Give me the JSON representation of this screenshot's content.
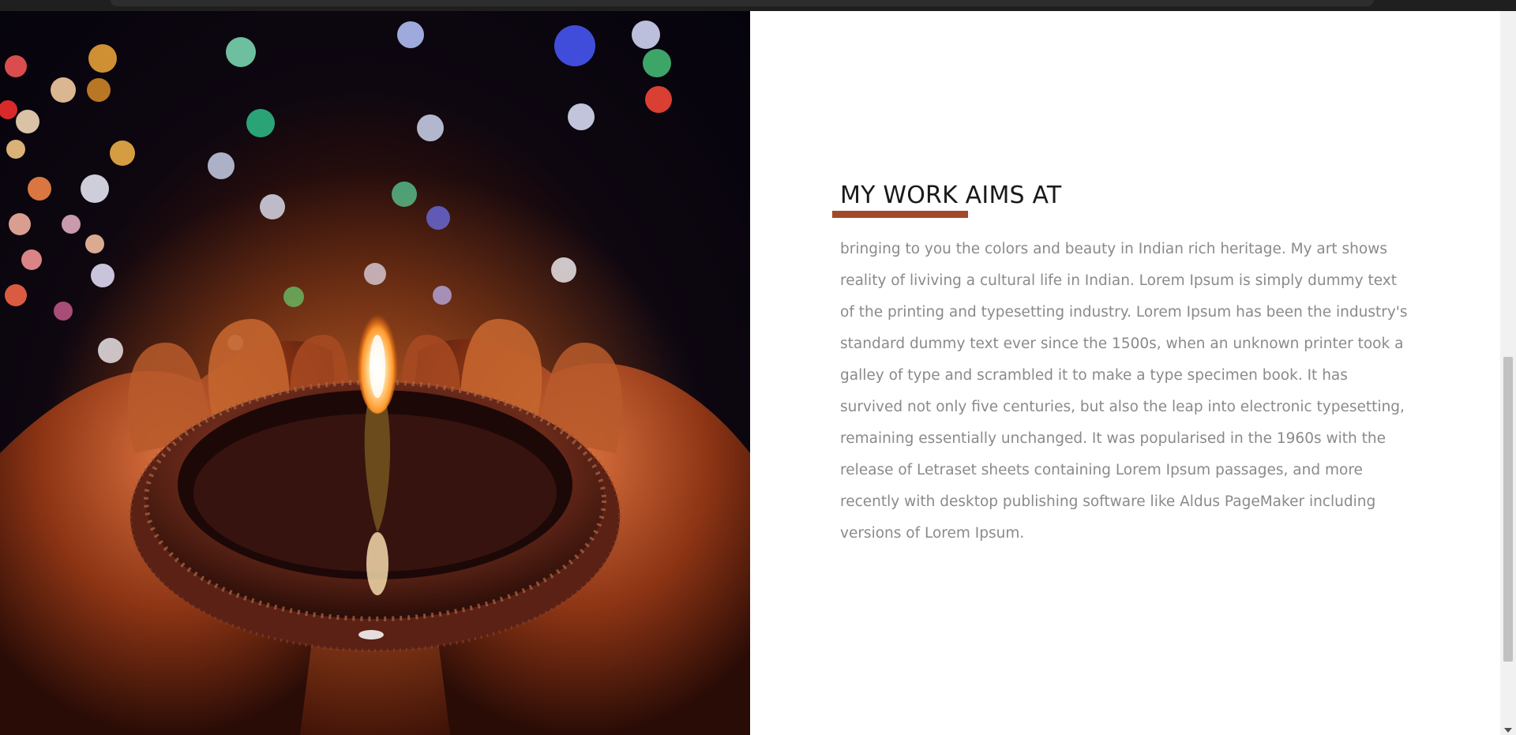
{
  "image": {
    "description_icon": "diya-lamp-photo-icon",
    "colors": {
      "accent": "#a2492a",
      "heading": "#1a1a1a",
      "body": "#8a8a8a"
    }
  },
  "section": {
    "heading": "MY WORK AIMS AT",
    "body": "bringing to you the colors and beauty in Indian rich heritage. My art shows reality of liviving a cultural life in Indian. Lorem Ipsum is simply dummy text of the printing and typesetting industry. Lorem Ipsum has been the industry's standard dummy text ever since the 1500s, when an unknown printer took a galley of type and scrambled it to make a type specimen book. It has survived not only five centuries, but also the leap into electronic typesetting, remaining essentially unchanged. It was popularised in the 1960s with the release of Letraset sheets containing Lorem Ipsum passages, and more recently with desktop publishing software like Aldus PageMaker including versions of Lorem Ipsum."
  }
}
